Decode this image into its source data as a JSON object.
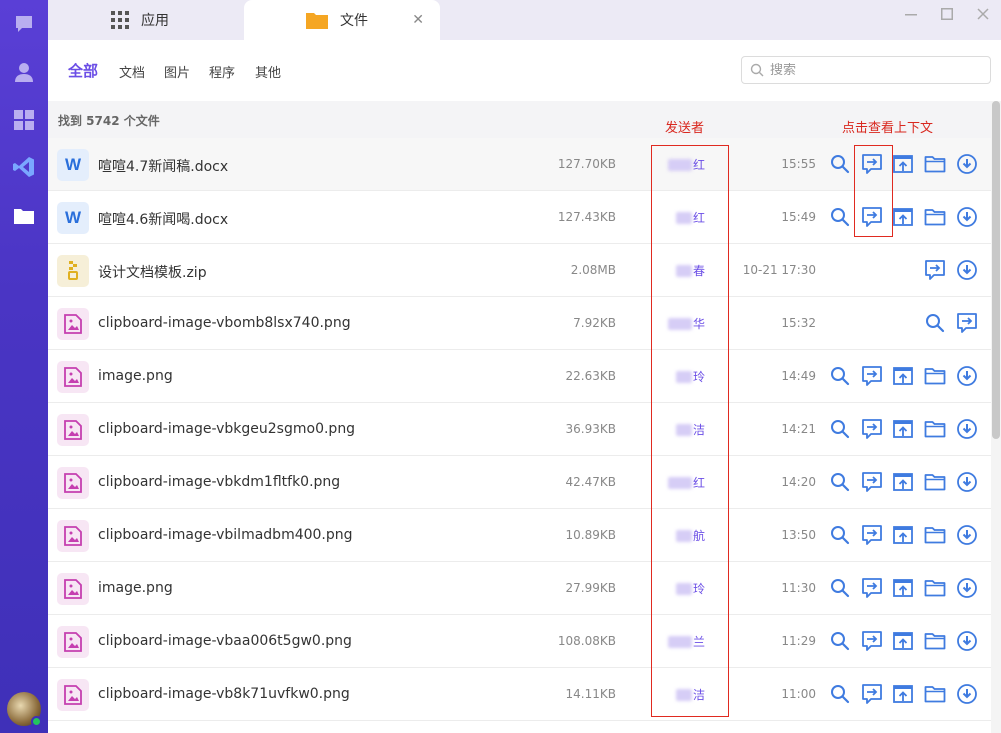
{
  "rail": {
    "items": [
      {
        "name": "chat-icon"
      },
      {
        "name": "contacts-icon"
      },
      {
        "name": "apps-grid-icon"
      },
      {
        "name": "vscode-icon"
      },
      {
        "name": "folder-icon"
      }
    ],
    "online": true
  },
  "tabs": [
    {
      "label": "应用",
      "icon": "apps-grid-icon"
    },
    {
      "label": "文件",
      "icon": "folder-icon",
      "active": true
    }
  ],
  "filters": {
    "items": [
      "全部",
      "文档",
      "图片",
      "程序",
      "其他"
    ],
    "active": "全部"
  },
  "search": {
    "placeholder": "搜索",
    "value": ""
  },
  "list": {
    "found_text": "找到 5742 个文件",
    "sender_column_title": "发送者",
    "context_column_title": "点击查看上下文",
    "rows": [
      {
        "type": "word",
        "name": "喧喧4.7新闻稿.docx",
        "size": "127.70KB",
        "sender": "红",
        "time": "15:55",
        "actions": [
          "search",
          "context",
          "share",
          "folder",
          "download"
        ]
      },
      {
        "type": "word",
        "name": "喧喧4.6新闻喝.docx",
        "size": "127.43KB",
        "sender": "红",
        "time": "15:49",
        "actions": [
          "search",
          "context",
          "share",
          "folder",
          "download"
        ]
      },
      {
        "type": "zip",
        "name": "设计文档模板.zip",
        "size": "2.08MB",
        "sender": "春",
        "time": "10-21 17:30",
        "actions": [
          "context",
          "download"
        ]
      },
      {
        "type": "img",
        "name": "clipboard-image-vbomb8lsx740.png",
        "size": "7.92KB",
        "sender": "华",
        "time": "15:32",
        "actions": [
          "search",
          "context"
        ]
      },
      {
        "type": "img",
        "name": "image.png",
        "size": "22.63KB",
        "sender": "玲",
        "time": "14:49",
        "actions": [
          "search",
          "context",
          "share",
          "folder",
          "download"
        ]
      },
      {
        "type": "img",
        "name": "clipboard-image-vbkgeu2sgmo0.png",
        "size": "36.93KB",
        "sender": "洁",
        "time": "14:21",
        "actions": [
          "search",
          "context",
          "share",
          "folder",
          "download"
        ]
      },
      {
        "type": "img",
        "name": "clipboard-image-vbkdm1fltfk0.png",
        "size": "42.47KB",
        "sender": "红",
        "time": "14:20",
        "actions": [
          "search",
          "context",
          "share",
          "folder",
          "download"
        ]
      },
      {
        "type": "img",
        "name": "clipboard-image-vbilmadbm400.png",
        "size": "10.89KB",
        "sender": "航",
        "time": "13:50",
        "actions": [
          "search",
          "context",
          "share",
          "folder",
          "download"
        ]
      },
      {
        "type": "img",
        "name": "image.png",
        "size": "27.99KB",
        "sender": "玲",
        "time": "11:30",
        "actions": [
          "search",
          "context",
          "share",
          "folder",
          "download"
        ]
      },
      {
        "type": "img",
        "name": "clipboard-image-vbaa006t5gw0.png",
        "size": "108.08KB",
        "sender": "兰",
        "time": "11:29",
        "actions": [
          "search",
          "context",
          "share",
          "folder",
          "download"
        ]
      },
      {
        "type": "img",
        "name": "clipboard-image-vb8k71uvfkw0.png",
        "size": "14.11KB",
        "sender": "洁",
        "time": "11:00",
        "actions": [
          "search",
          "context",
          "share",
          "folder",
          "download"
        ]
      }
    ]
  },
  "colors": {
    "accent": "#6b4ee6",
    "annotation": "#e02a20",
    "action_icon": "#3f7be0"
  }
}
